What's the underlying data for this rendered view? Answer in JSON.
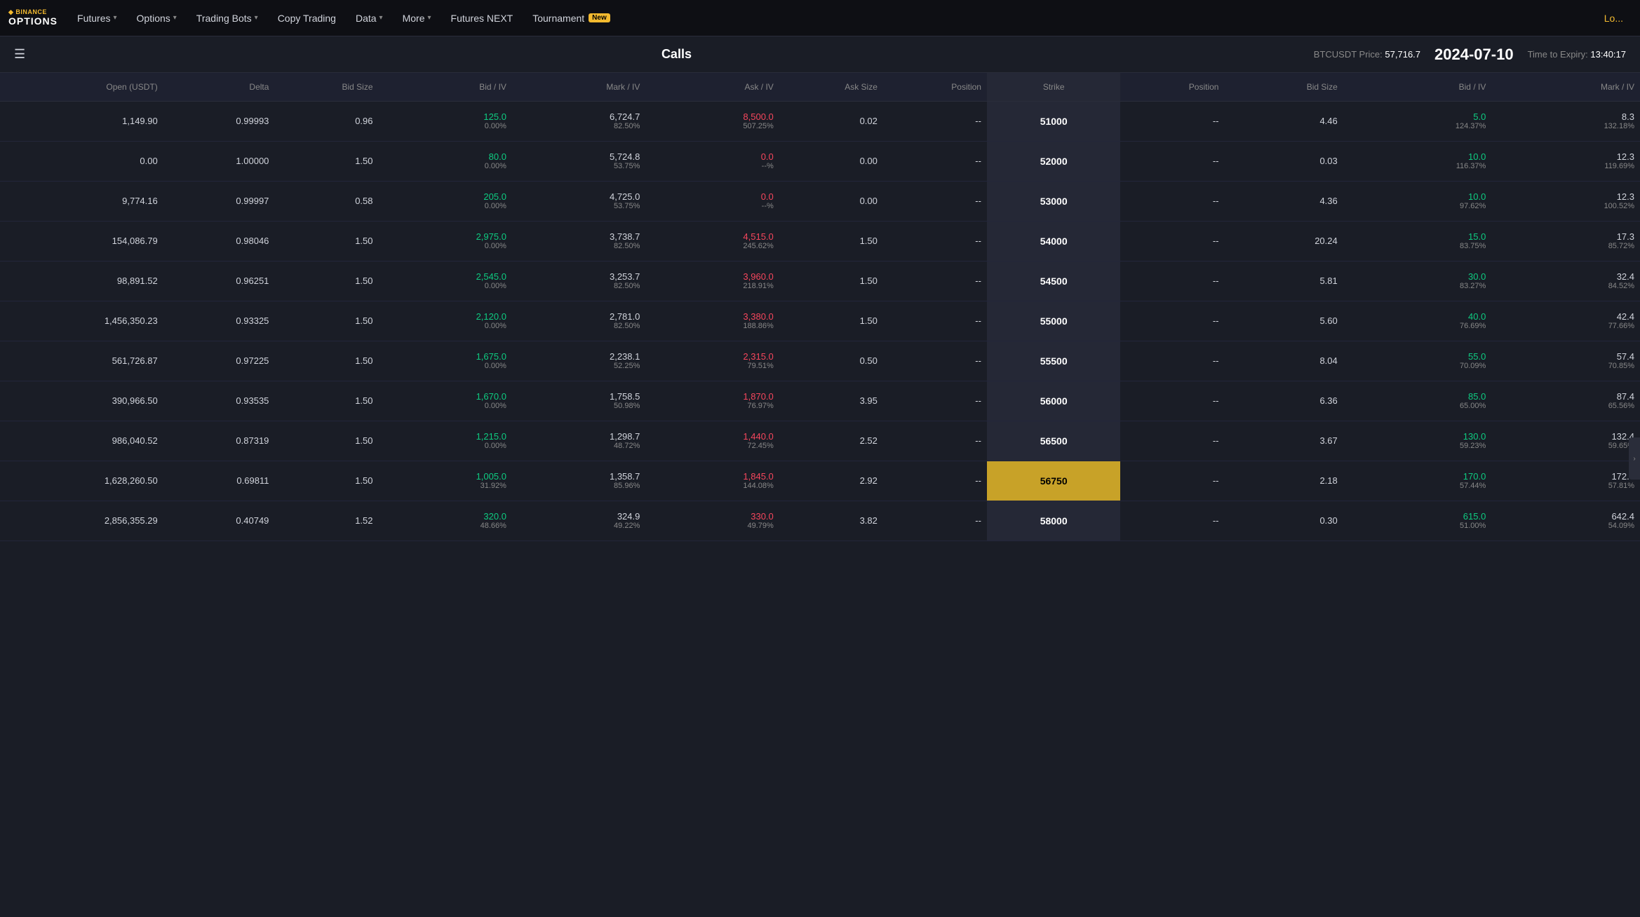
{
  "navbar": {
    "logo_top": "◆ BINANCE",
    "logo_bottom": "OPTIONS",
    "home_icon": "⌂",
    "futures_label": "Futures",
    "options_label": "Options",
    "trading_bots_label": "Trading Bots",
    "copy_trading_label": "Copy Trading",
    "data_label": "Data",
    "more_label": "More",
    "futures_next_label": "Futures NEXT",
    "tournament_label": "Tournament",
    "new_badge": "New",
    "login_label": "Lo..."
  },
  "subheader": {
    "menu_icon": "☰",
    "calls_title": "Calls",
    "btc_price_label": "BTCUSDT Price:",
    "btc_price_value": "57,716.7",
    "date_value": "2024-07-10",
    "expiry_label": "Time to Expiry:",
    "expiry_value": "13:40:17"
  },
  "table": {
    "headers_left": [
      "Open (USDT)",
      "Delta",
      "Bid Size",
      "Bid / IV",
      "Mark / IV",
      "Ask / IV",
      "Ask Size",
      "Position"
    ],
    "header_strike": "Strike",
    "headers_right": [
      "Position",
      "Bid Size",
      "Bid / IV",
      "Mark / IV"
    ],
    "rows": [
      {
        "open": "1,149.90",
        "delta": "0.99993",
        "bid_size": "0.96",
        "bid": "125.0",
        "bid_pct": "0.00%",
        "mark": "6,724.7",
        "mark_pct": "82.50%",
        "ask": "8,500.0",
        "ask_pct": "507.25%",
        "ask_size": "0.02",
        "position": "--",
        "strike": "51000",
        "r_position": "--",
        "r_bid_size": "4.46",
        "r_bid": "5.0",
        "r_bid_pct": "124.37%",
        "r_mark": "8.3",
        "r_mark_pct": "132.18%"
      },
      {
        "open": "0.00",
        "delta": "1.00000",
        "bid_size": "1.50",
        "bid": "80.0",
        "bid_pct": "0.00%",
        "mark": "5,724.8",
        "mark_pct": "53.75%",
        "ask": "0.0",
        "ask_pct": "--%",
        "ask_size": "0.00",
        "position": "--",
        "strike": "52000",
        "r_position": "--",
        "r_bid_size": "0.03",
        "r_bid": "10.0",
        "r_bid_pct": "116.37%",
        "r_mark": "12.3",
        "r_mark_pct": "119.69%"
      },
      {
        "open": "9,774.16",
        "delta": "0.99997",
        "bid_size": "0.58",
        "bid": "205.0",
        "bid_pct": "0.00%",
        "mark": "4,725.0",
        "mark_pct": "53.75%",
        "ask": "0.0",
        "ask_pct": "--%",
        "ask_size": "0.00",
        "position": "--",
        "strike": "53000",
        "r_position": "--",
        "r_bid_size": "4.36",
        "r_bid": "10.0",
        "r_bid_pct": "97.62%",
        "r_mark": "12.3",
        "r_mark_pct": "100.52%"
      },
      {
        "open": "154,086.79",
        "delta": "0.98046",
        "bid_size": "1.50",
        "bid": "2,975.0",
        "bid_pct": "0.00%",
        "mark": "3,738.7",
        "mark_pct": "82.50%",
        "ask": "4,515.0",
        "ask_pct": "245.62%",
        "ask_size": "1.50",
        "position": "--",
        "strike": "54000",
        "r_position": "--",
        "r_bid_size": "20.24",
        "r_bid": "15.0",
        "r_bid_pct": "83.75%",
        "r_mark": "17.3",
        "r_mark_pct": "85.72%"
      },
      {
        "open": "98,891.52",
        "delta": "0.96251",
        "bid_size": "1.50",
        "bid": "2,545.0",
        "bid_pct": "0.00%",
        "mark": "3,253.7",
        "mark_pct": "82.50%",
        "ask": "3,960.0",
        "ask_pct": "218.91%",
        "ask_size": "1.50",
        "position": "--",
        "strike": "54500",
        "r_position": "--",
        "r_bid_size": "5.81",
        "r_bid": "30.0",
        "r_bid_pct": "83.27%",
        "r_mark": "32.4",
        "r_mark_pct": "84.52%"
      },
      {
        "open": "1,456,350.23",
        "delta": "0.93325",
        "bid_size": "1.50",
        "bid": "2,120.0",
        "bid_pct": "0.00%",
        "mark": "2,781.0",
        "mark_pct": "82.50%",
        "ask": "3,380.0",
        "ask_pct": "188.86%",
        "ask_size": "1.50",
        "position": "--",
        "strike": "55000",
        "r_position": "--",
        "r_bid_size": "5.60",
        "r_bid": "40.0",
        "r_bid_pct": "76.69%",
        "r_mark": "42.4",
        "r_mark_pct": "77.66%"
      },
      {
        "open": "561,726.87",
        "delta": "0.97225",
        "bid_size": "1.50",
        "bid": "1,675.0",
        "bid_pct": "0.00%",
        "mark": "2,238.1",
        "mark_pct": "52.25%",
        "ask": "2,315.0",
        "ask_pct": "79.51%",
        "ask_size": "0.50",
        "position": "--",
        "strike": "55500",
        "r_position": "--",
        "r_bid_size": "8.04",
        "r_bid": "55.0",
        "r_bid_pct": "70.09%",
        "r_mark": "57.4",
        "r_mark_pct": "70.85%"
      },
      {
        "open": "390,966.50",
        "delta": "0.93535",
        "bid_size": "1.50",
        "bid": "1,670.0",
        "bid_pct": "0.00%",
        "mark": "1,758.5",
        "mark_pct": "50.98%",
        "ask": "1,870.0",
        "ask_pct": "76.97%",
        "ask_size": "3.95",
        "position": "--",
        "strike": "56000",
        "r_position": "--",
        "r_bid_size": "6.36",
        "r_bid": "85.0",
        "r_bid_pct": "65.00%",
        "r_mark": "87.4",
        "r_mark_pct": "65.56%"
      },
      {
        "open": "986,040.52",
        "delta": "0.87319",
        "bid_size": "1.50",
        "bid": "1,215.0",
        "bid_pct": "0.00%",
        "mark": "1,298.7",
        "mark_pct": "48.72%",
        "ask": "1,440.0",
        "ask_pct": "72.45%",
        "ask_size": "2.52",
        "position": "--",
        "strike": "56500",
        "r_position": "--",
        "r_bid_size": "3.67",
        "r_bid": "130.0",
        "r_bid_pct": "59.23%",
        "r_mark": "132.4",
        "r_mark_pct": "59.65%"
      },
      {
        "open": "1,628,260.50",
        "delta": "0.69811",
        "bid_size": "1.50",
        "bid": "1,005.0",
        "bid_pct": "31.92%",
        "mark": "1,358.7",
        "mark_pct": "85.96%",
        "ask": "1,845.0",
        "ask_pct": "144.08%",
        "ask_size": "2.92",
        "position": "--",
        "strike": "56750",
        "r_position": "--",
        "r_bid_size": "2.18",
        "r_bid": "170.0",
        "r_bid_pct": "57.44%",
        "r_mark": "172.4",
        "r_mark_pct": "57.81%",
        "highlight": true
      },
      {
        "open": "2,856,355.29",
        "delta": "0.40749",
        "bid_size": "1.52",
        "bid": "320.0",
        "bid_pct": "48.66%",
        "mark": "324.9",
        "mark_pct": "49.22%",
        "ask": "330.0",
        "ask_pct": "49.79%",
        "ask_size": "3.82",
        "position": "--",
        "strike": "58000",
        "r_position": "--",
        "r_bid_size": "0.30",
        "r_bid": "615.0",
        "r_bid_pct": "51.00%",
        "r_mark": "642.4",
        "r_mark_pct": "54.09%"
      }
    ]
  }
}
